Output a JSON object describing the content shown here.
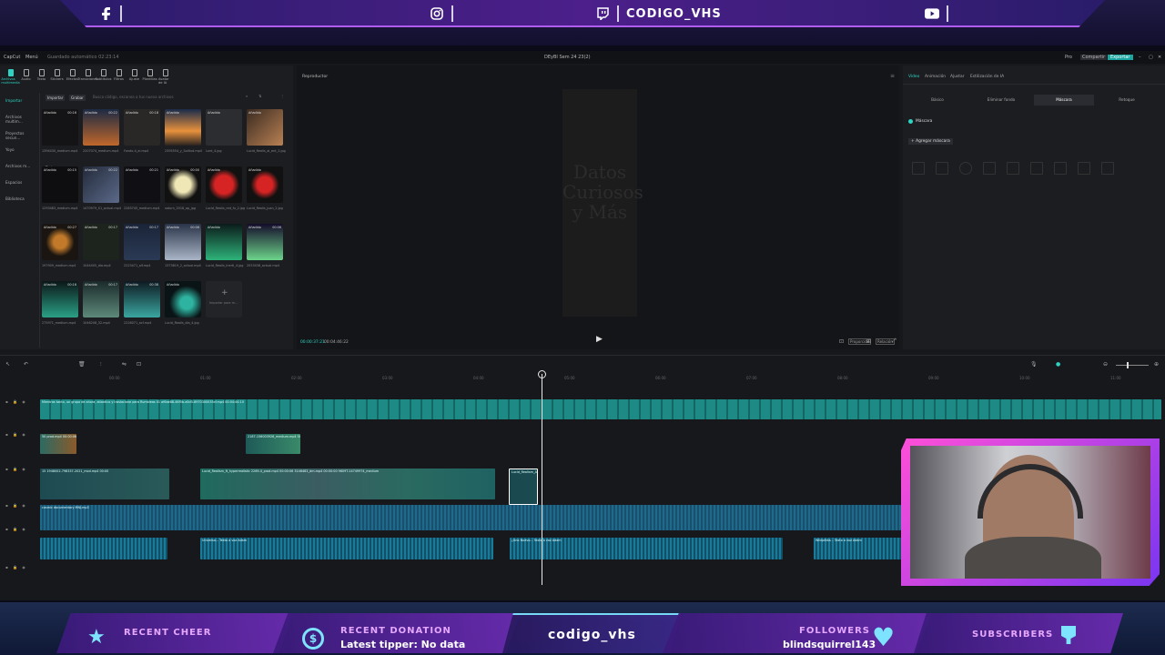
{
  "overlay_top": {
    "twitch_handle": "CODIGO_VHS",
    "icons": [
      "facebook-icon",
      "instagram-icon",
      "twitch-icon",
      "youtube-icon"
    ]
  },
  "app": {
    "title": "DEyBI Sem 24 23(2)",
    "logo": "CapCut",
    "menu": "Menú",
    "autosave": "Guardado automático 02:23:14",
    "pro": "Pro",
    "share": "Compartir",
    "export": "Exportar"
  },
  "toolbar": {
    "items": [
      "Archivos multimedia",
      "Audio",
      "Texto",
      "Stickers",
      "Efectos",
      "Transiciones",
      "Subtítulos",
      "Filtros",
      "Ajuste",
      "Plantillas",
      "Avatar de IA"
    ]
  },
  "sidenav": {
    "items": [
      "Importar",
      "Archivos multim...",
      "Proyectos secun...",
      "Yoyo",
      "Archivos m...",
      "Espacios",
      "Biblioteca"
    ]
  },
  "media_panel": {
    "import": "Importar",
    "record": "Grabar",
    "search_placeholder": "Busca código, escanea a tus nueva archivos",
    "filter": "Todos",
    "added_tag": "Añadido",
    "items": [
      {
        "name": "1394430_medium.mp4",
        "dur": "00:16"
      },
      {
        "name": "2207074_medium.mp4",
        "dur": "00:22"
      },
      {
        "name": "Fondo-4_ai.mp4",
        "dur": "00:18"
      },
      {
        "name": "2395554_y_Solitud.mp4",
        "dur": ""
      },
      {
        "name": "Lord_4.jpg",
        "dur": ""
      },
      {
        "name": "Lucid_Realis_al_ent_2.jpg",
        "dur": ""
      },
      {
        "name": "1293483_medium.mp4",
        "dur": "00:15"
      },
      {
        "name": "1470979_S1_actual.mp4",
        "dur": "00:22"
      },
      {
        "name": "2283745_medium.mp4",
        "dur": "00:21"
      },
      {
        "name": "saturn_2018_ap_jpg",
        "dur": "00:00"
      },
      {
        "name": "Lucid_Realis_red_fu_2.jpg",
        "dur": ""
      },
      {
        "name": "Lucid_Realis_juan_2.jpg",
        "dur": ""
      },
      {
        "name": "197909_medium.mp4",
        "dur": "00:27"
      },
      {
        "name": "1044405_dia.mp4",
        "dur": "00:17"
      },
      {
        "name": "2223471_alf.mp4",
        "dur": "00:17"
      },
      {
        "name": "1373819_2_actual.mp4",
        "dur": "00:06"
      },
      {
        "name": "Lucid_Realis_Inerti_4.jpg",
        "dur": ""
      },
      {
        "name": "2053438_actual.mp4",
        "dur": "00:06"
      },
      {
        "name": "275971_medium.mp4",
        "dur": "00:16"
      },
      {
        "name": "1046208_32.mp4",
        "dur": "00:17"
      },
      {
        "name": "2226071_acf.mp4",
        "dur": "00:38"
      },
      {
        "name": "Lucid_Realis_dia_4.jpg",
        "dur": ""
      }
    ],
    "add_more": "Importar para m..."
  },
  "player": {
    "label": "Reproductor",
    "preview_text": [
      "Datos",
      "Curiosos",
      "y Más"
    ],
    "current_time": "00:00:37:21",
    "total_time": "00:04:46:22",
    "ratio": "Proporción",
    "ratio2": "Relación"
  },
  "inspector": {
    "tabs": [
      "Video",
      "Animación",
      "Ajustar",
      "Estilización de IA"
    ],
    "active_tab": "Video",
    "subtabs": [
      "Básico",
      "Eliminar fondo",
      "Máscara",
      "Retoque"
    ],
    "active_subtab": "Máscara",
    "mask_label": "Máscara",
    "add_mask": "Agregar máscara"
  },
  "timeline": {
    "ruler": [
      "00:00",
      "01:00",
      "02:00",
      "03:00",
      "04:00",
      "05:00",
      "06:00",
      "07:00",
      "08:00",
      "09:00",
      "10:00",
      "11:00",
      "12:00"
    ],
    "clips": [
      {
        "track": "text",
        "label": "Mientras tanto, un grupo de ahora, atlantico y traslacione para Rumbieas 01 af6ae88-46f5b-a5d5-8970300035cf.mp4  00:04:44:10"
      },
      {
        "track": "video1a",
        "label": "50 prod.mp4  00:00:06"
      },
      {
        "track": "video1b",
        "label": "2187-156003926_medium.mp4  00:06"
      },
      {
        "track": "main1",
        "label": "15  1948002-798337-2021_mod.mp4  00:00"
      },
      {
        "track": "main2",
        "label": "Lucid_Realism_ft_hyperrealistic  2269-4_prod.mp4  00:00:06  3146483_dm.mp4  00:00:00  9609T-14749974_medium"
      },
      {
        "track": "main3",
        "label": "Lucid_Realism_A_"
      },
      {
        "track": "audio1",
        "label": "cosmic documentary MNJ.mp3"
      },
      {
        "track": "voice1",
        "label": "Universo...  Texto a voz Adam"
      },
      {
        "track": "voice2",
        "label": "¿Uno Nuevo...  Texto a voz Adam"
      },
      {
        "track": "voice3",
        "label": "Wikipédia...  Texto a voz Adam"
      }
    ]
  },
  "overlay_bottom": {
    "cheer_label": "RECENT CHEER",
    "donation_label": "RECENT DONATION",
    "donation_value": "Latest tipper: No data",
    "channel": "codigo_vhs",
    "followers_label": "FOLLOWERS",
    "followers_value": "blindsquirrel143",
    "subscribers_label": "SUBSCRIBERS"
  },
  "colors": {
    "accent": "#2ed3c2",
    "overlay_purple": "#6a2bb0",
    "overlay_pink": "#ff4fd8"
  }
}
